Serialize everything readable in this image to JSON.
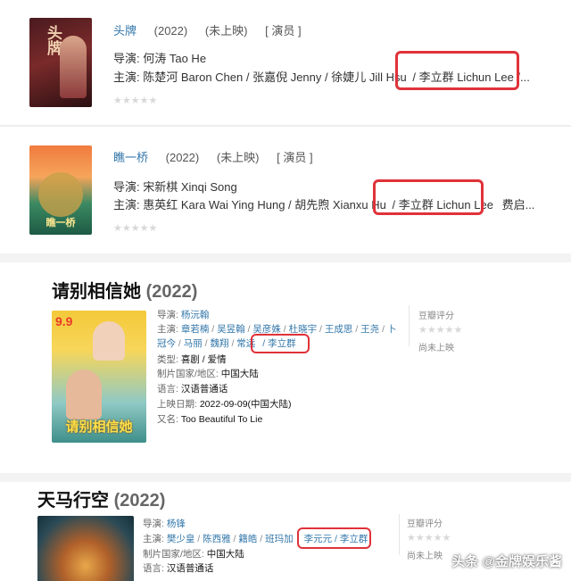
{
  "movie1": {
    "title": "头牌",
    "year": "(2022)",
    "status": "(未上映)",
    "role": "[ 演员 ]",
    "director_label": "导演:",
    "director": "何涛 Tao He",
    "cast_label": "主演:",
    "cast_before": "陈楚河 Baron Chen / 张嘉倪 Jenny / 徐婕儿 Jill Hsu",
    "cast_highlight": "/ 李立群 Lichun Lee /...",
    "poster_text": "头牌",
    "stars": "★★★★★"
  },
  "movie2": {
    "title": "瞧一桥",
    "year": "(2022)",
    "status": "(未上映)",
    "role": "[ 演员 ]",
    "director_label": "导演:",
    "director": "宋新棋 Xinqi Song",
    "cast_label": "主演:",
    "cast_before": "惠英红 Kara Wai Ying Hung / 胡先煦 Xianxu Hu",
    "cast_highlight": "/ 李立群 Lichun Lee",
    "cast_after": "费启...",
    "poster_text": "瞧一桥",
    "stars": "★★★★★"
  },
  "movie3": {
    "title": "请别相信她",
    "year": "(2022)",
    "director_label": "导演:",
    "director": "杨沅翰",
    "cast_label": "主演:",
    "cast_line1": [
      "章若楠",
      "吴昱翰",
      "吴彦姝",
      "杜晓宇",
      "王成思",
      "王尧",
      "卜"
    ],
    "cast_line2": [
      "冠今",
      "马丽",
      "魏翔",
      "常远"
    ],
    "cast_highlight": "/ 李立群",
    "genre_label": "类型:",
    "genre": "喜剧 / 爱情",
    "region_label": "制片国家/地区:",
    "region": "中国大陆",
    "lang_label": "语言:",
    "lang": "汉语普通话",
    "date_label": "上映日期:",
    "date": "2022-09-09(中国大陆)",
    "aka_label": "又名:",
    "aka": "Too Beautiful To Lie",
    "rating_title": "豆瓣评分",
    "rating_status": "尚未上映",
    "poster_date": "9.9",
    "poster_text": "请别相信她",
    "stars": "★★★★★"
  },
  "movie4": {
    "title": "天马行空",
    "year": "(2022)",
    "director_label": "导演:",
    "director": "杨锋",
    "cast_label": "主演:",
    "cast_line1": [
      "樊少皇",
      "陈西雅",
      "籍皓",
      "班玛加"
    ],
    "cast_highlight": "李元元 / 李立群",
    "region_label": "制片国家/地区:",
    "region": "中国大陆",
    "lang_label": "语言:",
    "lang": "汉语普通话",
    "rating_title": "豆瓣评分",
    "rating_status": "尚未上映",
    "stars": "★★★★★"
  },
  "watermark": "头条 @金牌娱乐酱",
  "colors": {
    "link": "#3377aa",
    "highlight_box": "#e0323a"
  }
}
